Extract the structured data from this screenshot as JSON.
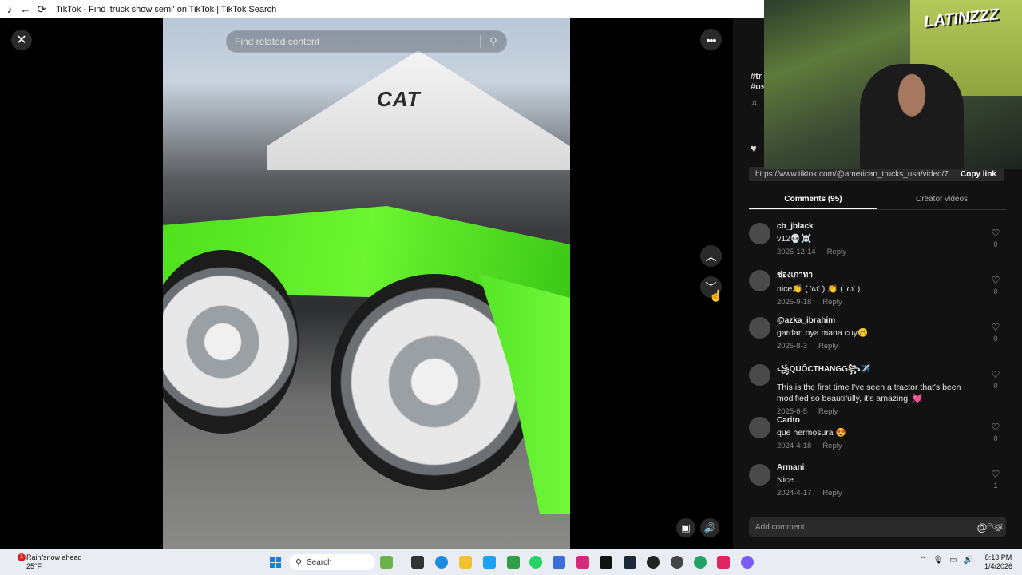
{
  "browser": {
    "title": "TikTok - Find 'truck show semi' on TikTok | TikTok Search",
    "back_icon": "arrow-left-icon",
    "reload_icon": "refresh-icon"
  },
  "player": {
    "search_placeholder": "Find related content",
    "video_brand_text": "CAT"
  },
  "panel": {
    "hashtag_1": "#tr",
    "hashtag_2": "#us",
    "music_glyph": "♫",
    "link_url": "https://www.tiktok.com/@american_trucks_usa/video/7...",
    "copy_link_label": "Copy link",
    "tabs": [
      {
        "label": "Comments (95)",
        "active": true
      },
      {
        "label": "Creator videos",
        "active": false
      }
    ],
    "reply_label": "Reply",
    "comments": [
      {
        "user": "cb_jblack",
        "text": "v12💀☠️",
        "date": "2025-12-14",
        "likes": "0"
      },
      {
        "user": "ช่องเกาทา",
        "text": "nice👏 ( 'ω' ) 👏 ( 'ω' )",
        "date": "2025-9-18",
        "likes": "0"
      },
      {
        "user": "@azka_ibrahim",
        "text": "gardan nya mana cuy🥴",
        "date": "2025-8-3",
        "likes": "0"
      },
      {
        "user": "꧁QUỐCTHANGG꧂✈️",
        "text": "This is the first time I've seen a tractor that's been modified so beautifully, it's amazing! 💓",
        "date": "2025-6-5",
        "likes": "0"
      },
      {
        "user": "Carito",
        "text": "que hermosura 😍",
        "date": "2024-4-18",
        "likes": "0"
      },
      {
        "user": "Armani",
        "text": "Nice...",
        "date": "2024-4-17",
        "likes": "1"
      }
    ],
    "add_comment_placeholder": "Add comment...",
    "post_label": "Post"
  },
  "webcam": {
    "sign_text": "LATINZZZ"
  },
  "taskbar": {
    "weather_title": "Rain/snow ahead",
    "weather_temp": "25°F",
    "notification_count": "1",
    "search_label": "Search",
    "time": "8:13 PM",
    "date": "1/4/2026"
  }
}
